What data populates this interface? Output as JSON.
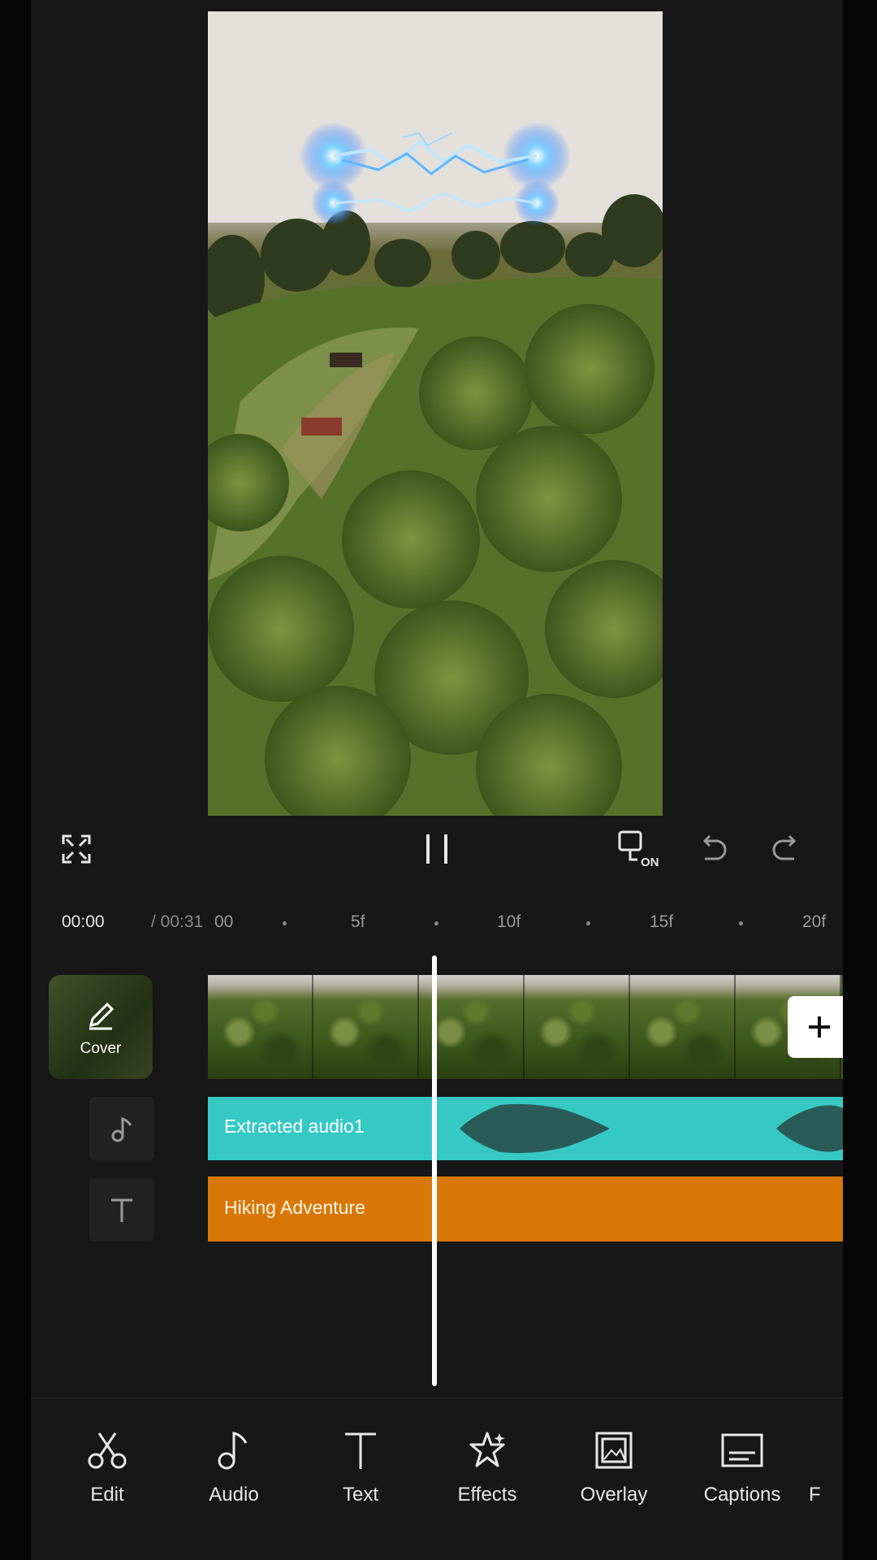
{
  "player": {
    "fullscreen_icon": "expand-icon",
    "play_state_icon": "pause-icon",
    "sync_toggle_label": "ON",
    "undo_icon": "undo-icon",
    "redo_icon": "redo-icon"
  },
  "ruler": {
    "current_time": "00:00",
    "total_time": "/ 00:31",
    "ticks": [
      "00",
      "5f",
      "10f",
      "15f",
      "20f"
    ]
  },
  "timeline": {
    "cover_label": "Cover",
    "audio_clip_label": "Extracted audio1",
    "text_clip_label": "Hiking Adventure",
    "add_clip_icon": "plus-icon",
    "audio_track_icon": "music-note-icon",
    "text_track_icon": "text-icon"
  },
  "colors": {
    "audio_waveform": "#36c9c4",
    "text_clip": "#d97706",
    "background": "#171717"
  },
  "toolbar": {
    "items": [
      {
        "label": "Edit",
        "icon": "scissors-icon"
      },
      {
        "label": "Audio",
        "icon": "music-note-icon"
      },
      {
        "label": "Text",
        "icon": "text-icon"
      },
      {
        "label": "Effects",
        "icon": "star-effects-icon"
      },
      {
        "label": "Overlay",
        "icon": "overlay-icon"
      },
      {
        "label": "Captions",
        "icon": "captions-icon"
      }
    ],
    "cut_off_label": "F"
  }
}
